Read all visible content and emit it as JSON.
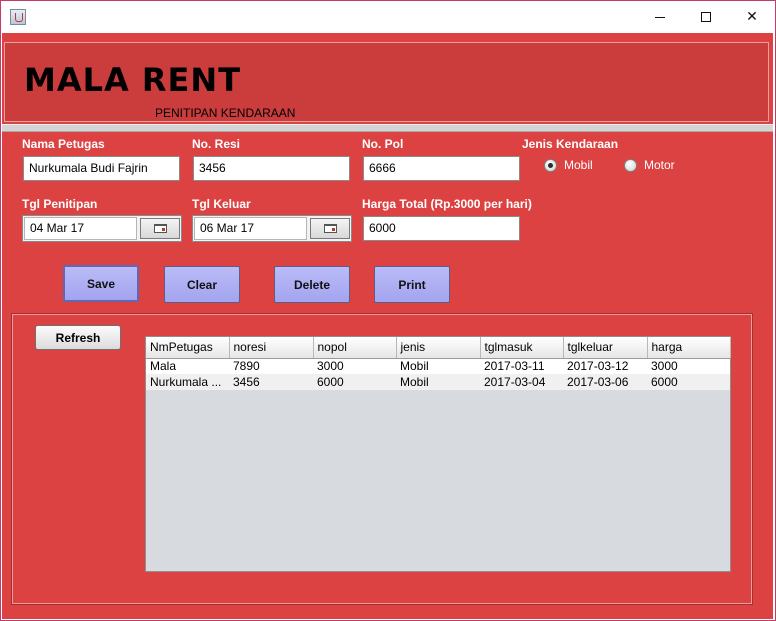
{
  "app": {
    "logo": "MALA RENT",
    "subtitle": "PENITIPAN KENDARAAN"
  },
  "form": {
    "nama_petugas": {
      "label": "Nama Petugas",
      "value": "Nurkumala Budi Fajrin"
    },
    "no_resi": {
      "label": "No. Resi",
      "value": "3456"
    },
    "no_pol": {
      "label": "No. Pol",
      "value": "6666"
    },
    "jenis_kendaraan": {
      "label": "Jenis Kendaraan",
      "options": [
        "Mobil",
        "Motor"
      ],
      "selected": "Mobil"
    },
    "tgl_penitipan": {
      "label": "Tgl Penitipan",
      "value": "04 Mar 17"
    },
    "tgl_keluar": {
      "label": "Tgl Keluar",
      "value": "06 Mar 17"
    },
    "harga_total": {
      "label": "Harga Total (Rp.3000 per hari)",
      "value": "6000"
    }
  },
  "buttons": {
    "save": "Save",
    "clear": "Clear",
    "delete": "Delete",
    "print": "Print",
    "refresh": "Refresh"
  },
  "table": {
    "columns": [
      "NmPetugas",
      "noresi",
      "nopol",
      "jenis",
      "tglmasuk",
      "tglkeluar",
      "harga"
    ],
    "rows": [
      [
        "Mala",
        "7890",
        "3000",
        "Mobil",
        "2017-03-11",
        "2017-03-12",
        "3000"
      ],
      [
        "Nurkumala ...",
        "3456",
        "6000",
        "Mobil",
        "2017-03-04",
        "2017-03-06",
        "6000"
      ]
    ]
  },
  "colors": {
    "frame": "#dc4242",
    "header": "#cb3c3c",
    "button": "#a3a4ef",
    "table_bg": "#d7dadf"
  },
  "icons": {
    "app": "java-cup-icon",
    "minimize": "minimize-icon",
    "maximize": "maximize-icon",
    "close": "close-icon",
    "calendar": "calendar-icon"
  }
}
